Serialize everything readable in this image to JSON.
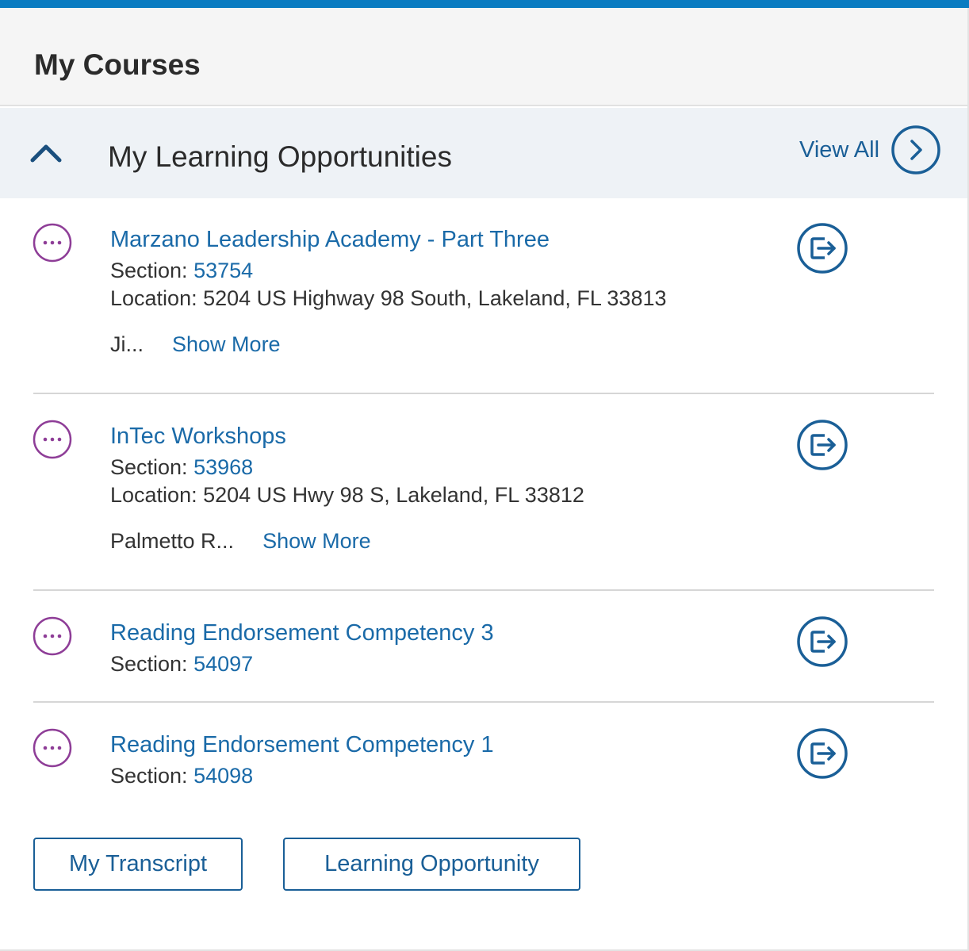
{
  "header": {
    "title": "My Courses"
  },
  "section": {
    "title": "My Learning Opportunities",
    "view_all_label": "View All"
  },
  "items": [
    {
      "title": "Marzano Leadership Academy - Part Three",
      "section_label": "Section: ",
      "section_value": "53754",
      "location": "Location: 5204 US Highway 98 South, Lakeland, FL 33813",
      "extra": "Ji...",
      "show_more": "Show More"
    },
    {
      "title": "InTec Workshops",
      "section_label": "Section: ",
      "section_value": "53968",
      "location": "Location: 5204 US Hwy 98 S, Lakeland, FL 33812",
      "extra": "Palmetto R...",
      "show_more": "Show More"
    },
    {
      "title": "Reading Endorsement Competency 3",
      "section_label": "Section: ",
      "section_value": "54097"
    },
    {
      "title": "Reading Endorsement Competency 1",
      "section_label": "Section: ",
      "section_value": "54098"
    }
  ],
  "buttons": {
    "transcript": "My Transcript",
    "learning_opportunity": "Learning Opportunity"
  },
  "colors": {
    "accent": "#0a7cc1",
    "link": "#1a6aa8",
    "more_icon": "#8e3d97"
  },
  "icons": {
    "collapse": "chevron-up-icon",
    "view_all": "chevron-right-circle-icon",
    "more": "ellipsis-circle-icon",
    "launch": "launch-exit-icon"
  }
}
